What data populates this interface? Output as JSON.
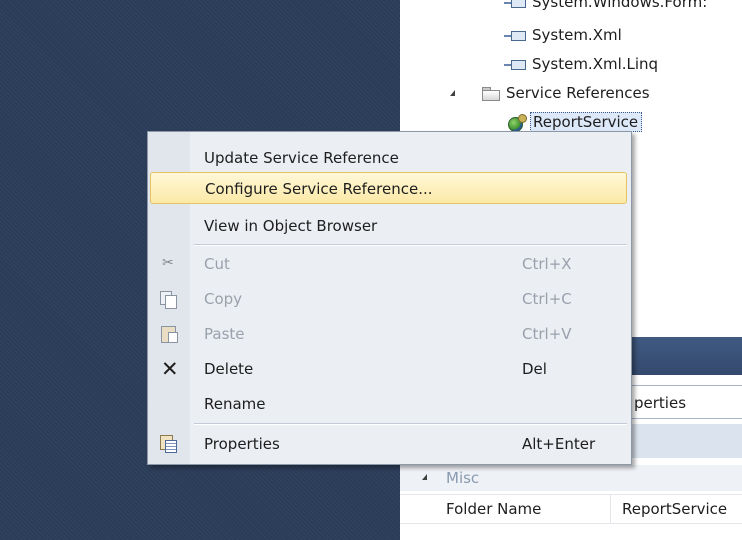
{
  "solution_explorer": {
    "items": [
      {
        "label": "System.Windows.Form:"
      },
      {
        "label": "System.Xml"
      },
      {
        "label": "System.Xml.Linq"
      },
      {
        "label": "Service References"
      },
      {
        "label": "ReportService"
      }
    ]
  },
  "context_menu": {
    "items": [
      {
        "label": "Update Service Reference",
        "shortcut": "",
        "state": "normal"
      },
      {
        "label": "Configure Service Reference...",
        "shortcut": "",
        "state": "highlighted"
      },
      {
        "label": "View in Object Browser",
        "shortcut": "",
        "state": "normal"
      },
      {
        "label": "Cut",
        "shortcut": "Ctrl+X",
        "state": "disabled",
        "icon": "scissors-icon"
      },
      {
        "label": "Copy",
        "shortcut": "Ctrl+C",
        "state": "disabled",
        "icon": "copy-icon"
      },
      {
        "label": "Paste",
        "shortcut": "Ctrl+V",
        "state": "disabled",
        "icon": "paste-icon"
      },
      {
        "label": "Delete",
        "shortcut": "Del",
        "state": "normal",
        "icon": "delete-icon"
      },
      {
        "label": "Rename",
        "shortcut": "",
        "state": "normal"
      },
      {
        "label": "Properties",
        "shortcut": "Alt+Enter",
        "state": "normal",
        "icon": "properties-icon"
      }
    ]
  },
  "properties_panel": {
    "object_text": "perties",
    "category": "Misc",
    "rows": [
      {
        "name": "Folder Name",
        "value": "ReportService"
      }
    ]
  },
  "colors": {
    "background": "#2b3c59",
    "menu_highlight": "#fbe9a6",
    "menu_highlight_border": "#e5c365",
    "disabled_text": "#9aa1ac"
  }
}
